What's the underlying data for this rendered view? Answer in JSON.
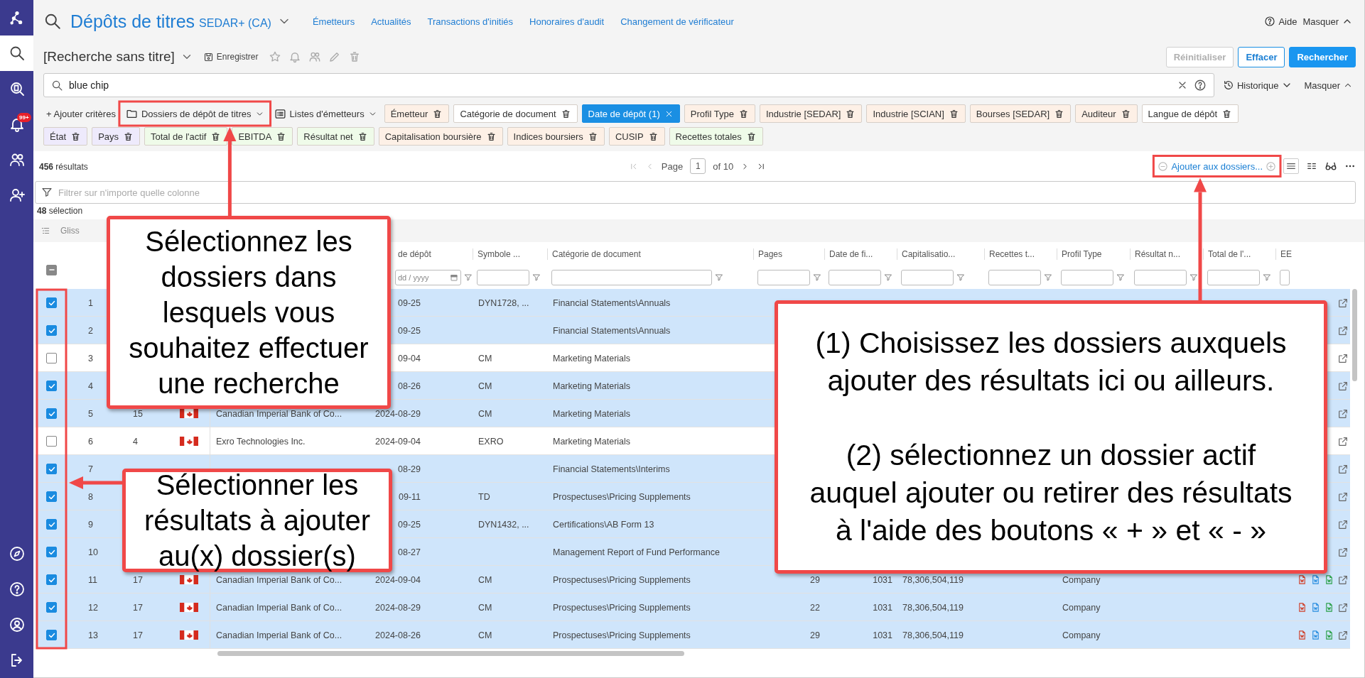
{
  "sidebar": {
    "items": [
      {
        "selected": true
      },
      {
        "selected": false
      },
      {
        "selected": false,
        "badge": "99+"
      },
      {
        "selected": false
      },
      {
        "selected": false
      }
    ],
    "bottom_items": [
      {
        "selected": false
      },
      {
        "selected": false
      },
      {
        "selected": false
      },
      {
        "selected": false
      }
    ]
  },
  "header": {
    "title": "Dépôts de titres",
    "source": "SEDAR+ (CA)",
    "nav": [
      "Émetteurs",
      "Actualités",
      "Transactions d'initiés",
      "Honoraires d'audit",
      "Changement de vérificateur"
    ],
    "help": "Aide",
    "hide": "Masquer"
  },
  "search_bar": {
    "name": "[Recherche sans titre]",
    "save": "Enregistrer",
    "buttons": [
      {
        "label": "Réinitialiser",
        "kind": "secondary",
        "disabled": true
      },
      {
        "label": "Effacer",
        "kind": "outline",
        "disabled": false
      },
      {
        "label": "Rechercher",
        "kind": "primary",
        "disabled": false
      }
    ]
  },
  "query": {
    "value": "blue chip",
    "history": "Historique",
    "hide": "Masquer"
  },
  "criteria": {
    "add": "+ Ajouter critères",
    "folders": "Dossiers de dépôt de titres",
    "lists": "Listes d'émetteurs",
    "first_line": [
      {
        "label": "Émetteur",
        "color": "#fdf0e6",
        "active": false
      },
      {
        "label": "Catégorie de document",
        "color": "#ffffff",
        "active": false
      },
      {
        "label": "Date de dépôt (1)",
        "color": "#1a8fe3",
        "active": true
      },
      {
        "label": "Profil Type",
        "color": "#fdf0e6",
        "active": false
      },
      {
        "label": "Industrie [SEDAR]",
        "color": "#fdf0e6",
        "active": false
      },
      {
        "label": "Industrie [SCIAN]",
        "color": "#fdf0e6",
        "active": false
      },
      {
        "label": "Bourses [SEDAR]",
        "color": "#fdf0e6",
        "active": false
      },
      {
        "label": "Auditeur",
        "color": "#fdf0e6",
        "active": false
      },
      {
        "label": "Langue de dépôt",
        "color": "#ffffff",
        "active": false
      }
    ],
    "second_line": [
      {
        "label": "État",
        "color": "#eeeafc",
        "active": false
      },
      {
        "label": "Pays",
        "color": "#eeeafc",
        "active": false
      },
      {
        "label": "Total de l'actif",
        "color": "#effbe9",
        "active": false
      },
      {
        "label": "EBITDA",
        "color": "#effbe9",
        "active": false
      },
      {
        "label": "Résultat net",
        "color": "#effbe9",
        "active": false
      },
      {
        "label": "Capitalisation boursière",
        "color": "#fdf0e6",
        "active": false
      },
      {
        "label": "Indices boursiers",
        "color": "#fdf0e6",
        "active": false
      },
      {
        "label": "CUSIP",
        "color": "#fdf0e6",
        "active": false
      },
      {
        "label": "Recettes totales",
        "color": "#effbe9",
        "active": false
      }
    ]
  },
  "results": {
    "count": "**456** résultats",
    "page_label": "Page",
    "page": "1",
    "page_total": "of 10",
    "add_to_folders": "Ajouter aux dossiers...",
    "filter_placeholder": "Filtrer sur n'importe quelle colonne",
    "selected_count": "**48** sélection",
    "group_hint": "Gliss"
  },
  "table": {
    "header_checkbox": {
      "indeterminate": true
    },
    "columns": [
      {
        "kind": "none"
      },
      {
        "kind": "none"
      },
      {
        "kind": "none"
      },
      {
        "kind": "none"
      },
      {
        "label": "de dépôt",
        "kind": "date",
        "placeholder": "dd / yyyy"
      },
      {
        "label": "Symbole ...",
        "kind": "text"
      },
      {
        "label": "Catégorie de document",
        "kind": "text"
      },
      {
        "label": "Pages",
        "kind": "text"
      },
      {
        "label": "Date de fi...",
        "kind": "text"
      },
      {
        "label": "Capitalisatio...",
        "kind": "text"
      },
      {
        "label": "Recettes t...",
        "kind": "text"
      },
      {
        "label": "Profil Type",
        "kind": "text"
      },
      {
        "label": "Résultat n...",
        "kind": "text"
      },
      {
        "label": "Total de l'...",
        "kind": "text"
      },
      {
        "label": "EE",
        "kind": "text"
      }
    ],
    "rows": [
      {
        "selected": true,
        "number": "1",
        "filing_date": "09-25",
        "symbol": "DYN1728, ...",
        "category": "Financial Statements\\Annuals"
      },
      {
        "selected": true,
        "number": "2",
        "filing_date": "09-25",
        "category": "Financial Statements\\Annuals"
      },
      {
        "selected": false,
        "number": "3",
        "filing_date": "09-04",
        "symbol": "CM",
        "category": "Marketing Materials"
      },
      {
        "selected": true,
        "number": "4",
        "filing_date": "08-26",
        "symbol": "CM",
        "category": "Marketing Materials"
      },
      {
        "selected": true,
        "number": "5",
        "count": "15",
        "flag": true,
        "issuer": "Canadian Imperial Bank of Co...",
        "filing_date": "2024-08-29",
        "symbol": "CM",
        "category": "Marketing Materials"
      },
      {
        "selected": false,
        "number": "6",
        "count": "4",
        "flag": true,
        "issuer": "Exro Technologies Inc.",
        "filing_date": "2024-09-04",
        "symbol": "EXRO",
        "category": "Marketing Materials"
      },
      {
        "selected": true,
        "number": "7",
        "filing_date": "08-29",
        "category": "Financial Statements\\Interims"
      },
      {
        "selected": true,
        "number": "8",
        "filing_date": "09-11",
        "symbol": "TD",
        "category": "Prospectuses\\Pricing Supplements"
      },
      {
        "selected": true,
        "number": "9",
        "filing_date": "09-25",
        "symbol": "DYN1432, ...",
        "category": "Certifications\\AB Form 13"
      },
      {
        "selected": true,
        "number": "10",
        "filing_date": "08-27",
        "category": "Management Report of Fund Performance"
      },
      {
        "selected": true,
        "number": "11",
        "count": "17",
        "flag": true,
        "issuer": "Canadian Imperial Bank of Co...",
        "filing_date": "2024-09-04",
        "symbol": "CM",
        "category": "Prospectuses\\Pricing Supplements",
        "pages": "29",
        "date_de_fi": "1031",
        "capitalisation": "78,306,504,119",
        "profil_type": "Company",
        "files": true
      },
      {
        "selected": true,
        "number": "12",
        "count": "17",
        "flag": true,
        "issuer": "Canadian Imperial Bank of Co...",
        "filing_date": "2024-08-29",
        "symbol": "CM",
        "category": "Prospectuses\\Pricing Supplements",
        "pages": "22",
        "date_de_fi": "1031",
        "capitalisation": "78,306,504,119",
        "profil_type": "Company",
        "files": true
      },
      {
        "selected": true,
        "number": "13",
        "count": "17",
        "flag": true,
        "issuer": "Canadian Imperial Bank of Co...",
        "filing_date": "2024-08-26",
        "symbol": "CM",
        "category": "Prospectuses\\Pricing Supplements",
        "pages": "29",
        "date_de_fi": "1031",
        "capitalisation": "78,306,504,119",
        "profil_type": "Company",
        "files": true
      }
    ]
  },
  "annotations": [
    {
      "paragraphs": [
        "Sélectionnez les\ndossiers dans\nlesquels vous\nsouhaitez effectuer\nune recherche"
      ]
    },
    {
      "paragraphs": [
        "Sélectionner les\nrésultats à ajouter\nau(x) dossier(s)"
      ]
    },
    {
      "paragraphs": [
        "(1) Choisissez les dossiers auxquels\najouter des résultats ici ou ailleurs.",
        "(2) sélectionnez un dossier actif\nauquel ajouter ou retirer des résultats\nà l'aide des boutons « + » et « - »"
      ]
    }
  ]
}
